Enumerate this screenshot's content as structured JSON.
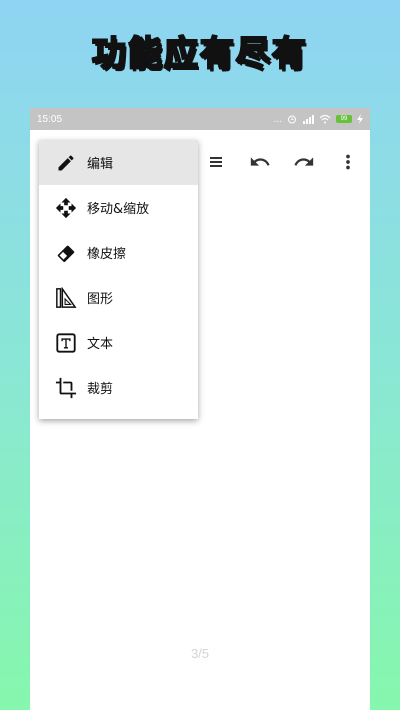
{
  "headline": "功能应有尽有",
  "status_bar": {
    "time": "15:05",
    "dots": "...",
    "battery": "99"
  },
  "menu": {
    "items": [
      {
        "label": "编辑",
        "icon": "pencil-icon"
      },
      {
        "label": "移动&缩放",
        "icon": "move-icon"
      },
      {
        "label": "橡皮擦",
        "icon": "eraser-icon"
      },
      {
        "label": "图形",
        "icon": "shapes-icon"
      },
      {
        "label": "文本",
        "icon": "text-icon"
      },
      {
        "label": "裁剪",
        "icon": "crop-icon"
      }
    ]
  },
  "toolbar": {
    "icons": [
      "list-icon",
      "undo-icon",
      "redo-icon",
      "more-vert-icon"
    ]
  },
  "page_indicator": "3/5",
  "colors": {
    "battery": "#68c13a",
    "status_bar": "#c4c4c4",
    "active_item": "#e6e6e6"
  }
}
